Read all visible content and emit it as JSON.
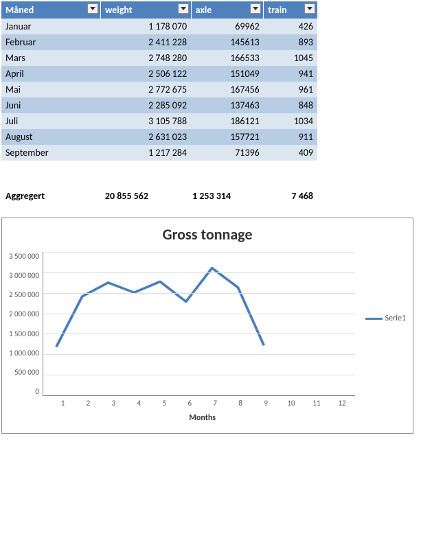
{
  "table": {
    "headers": [
      "Måned",
      "weight",
      "axle",
      "train"
    ],
    "rows": [
      {
        "month": "Januar",
        "weight": "1 178 070",
        "axle": "69962",
        "train": "426"
      },
      {
        "month": "Februar",
        "weight": "2 411 228",
        "axle": "145613",
        "train": "893"
      },
      {
        "month": "Mars",
        "weight": "2 748 280",
        "axle": "166533",
        "train": "1045"
      },
      {
        "month": "April",
        "weight": "2 506 122",
        "axle": "151049",
        "train": "941"
      },
      {
        "month": "Mai",
        "weight": "2 772 675",
        "axle": "167456",
        "train": "961"
      },
      {
        "month": "Juni",
        "weight": "2 285 092",
        "axle": "137463",
        "train": "848"
      },
      {
        "month": "Juli",
        "weight": "3 105 788",
        "axle": "186121",
        "train": "1034"
      },
      {
        "month": "August",
        "weight": "2 631 023",
        "axle": "157721",
        "train": "911"
      },
      {
        "month": "September",
        "weight": "1 217 284",
        "axle": "71396",
        "train": "409"
      }
    ]
  },
  "aggregate": {
    "label": "Aggregert",
    "weight": "20 855 562",
    "axle": "1 253 314",
    "train": "7 468"
  },
  "chart_data": {
    "type": "line",
    "title": "Gross tonnage",
    "xlabel": "Months",
    "ylabel": "",
    "ylim": [
      0,
      3500000
    ],
    "y_ticks": [
      "3 500 000",
      "3 000 000",
      "2 500 000",
      "2 000 000",
      "1 500 000",
      "1 000 000",
      "500 000",
      "0"
    ],
    "x_ticks": [
      "1",
      "2",
      "3",
      "4",
      "5",
      "6",
      "7",
      "8",
      "9",
      "10",
      "11",
      "12"
    ],
    "categories": [
      1,
      2,
      3,
      4,
      5,
      6,
      7,
      8,
      9,
      10,
      11,
      12
    ],
    "series": [
      {
        "name": "Serie1",
        "values": [
          1178070,
          2411228,
          2748280,
          2506122,
          2772675,
          2285092,
          3105788,
          2631023,
          1217284
        ]
      }
    ],
    "legend_position": "right",
    "grid": true,
    "color": "#4a7ebb"
  }
}
